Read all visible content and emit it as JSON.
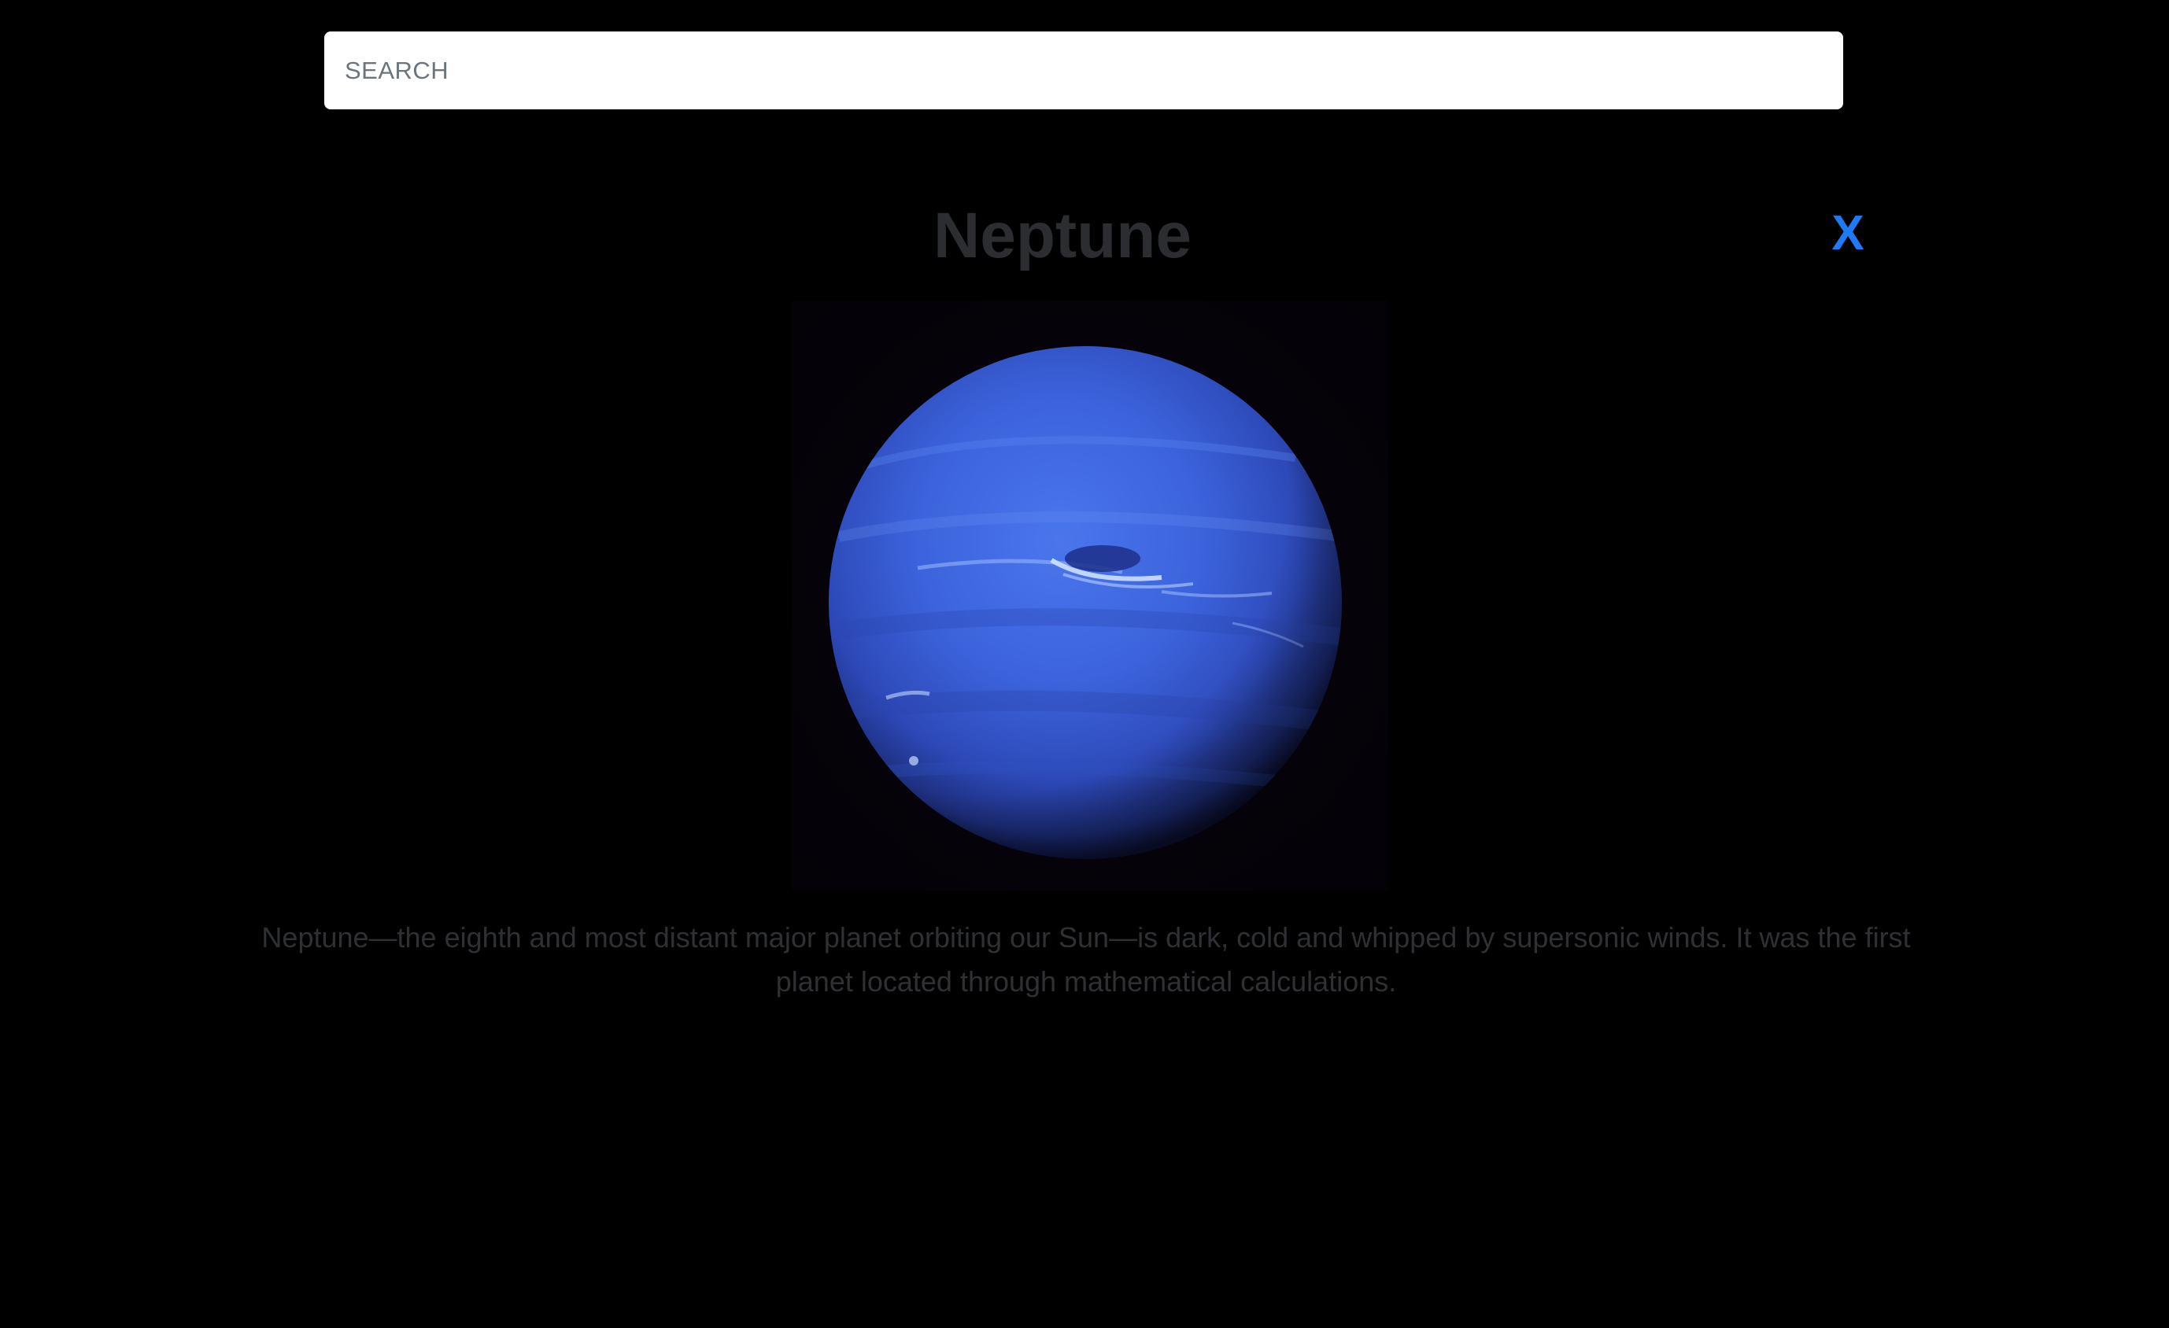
{
  "search": {
    "placeholder": "SEARCH",
    "value": ""
  },
  "modal": {
    "title": "Neptune",
    "close_label": "X",
    "image_alt": "Neptune",
    "description": "Neptune—the eighth and most distant major planet orbiting our Sun—is dark, cold and whipped by supersonic winds. It was the first planet located through mathematical calculations."
  },
  "colors": {
    "background": "#000000",
    "close_accent": "#1f7af8",
    "planet_blue": "#3d63e0"
  }
}
